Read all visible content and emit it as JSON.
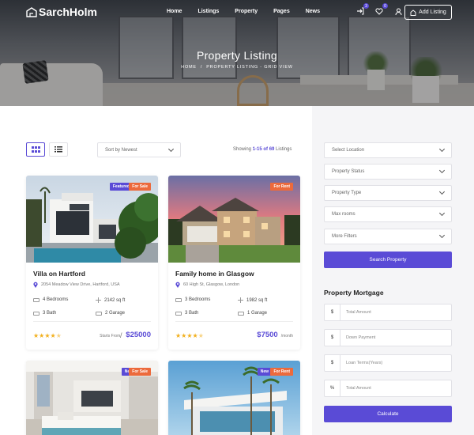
{
  "brand": {
    "name": "SarchHolm",
    "accent": "#5a4bd6",
    "tag_orange": "#ec6a3c"
  },
  "nav": {
    "items": [
      "Home",
      "Listings",
      "Property",
      "Pages",
      "News"
    ],
    "icons": [
      {
        "name": "sign-in-icon",
        "badge": "3"
      },
      {
        "name": "heart-icon",
        "badge": "0"
      },
      {
        "name": "user-icon",
        "badge": ""
      }
    ],
    "add_listing": "Add Listing"
  },
  "hero": {
    "title": "Property Listing",
    "breadcrumb": [
      "HOME",
      "PROPERTY LISTING - GRID VIEW"
    ]
  },
  "toolbar": {
    "sort": "Sort by Newest",
    "showing_prefix": "Showing",
    "showing_range": "1-15 of 69",
    "showing_suffix": "Listings"
  },
  "listings": [
    {
      "tags": [
        "Featured",
        "For Sale"
      ],
      "title": "Villa on Hartford",
      "address": "2054 Meadow View Drive, Hartford, USA",
      "beds": "4 Bedrooms",
      "area": "2142 sq ft",
      "baths": "3 Bath",
      "garage": "2 Garage",
      "rating": 3.5,
      "price_prefix": "Starts From",
      "price": "$25000",
      "price_suffix": ""
    },
    {
      "tags": [
        "For Rent"
      ],
      "title": "Family home in Glasgow",
      "address": "60 High St, Glasgow, London",
      "beds": "3 Bedrooms",
      "area": "1982 sq ft",
      "baths": "3 Bath",
      "garage": "1 Garage",
      "rating": 3.5,
      "price_prefix": "",
      "price": "$7500",
      "price_suffix": "/month"
    },
    {
      "tags": [
        "New",
        "For Sale"
      ]
    },
    {
      "tags": [
        "New",
        "For Rent"
      ]
    }
  ],
  "sidebar": {
    "selects": [
      "Select Location",
      "Property Status",
      "Property Type",
      "Max rooms",
      "More Filters"
    ],
    "search_button": "Search Property",
    "mortgage_title": "Property Mortgage",
    "mortgage_fields": [
      {
        "prefix": "$",
        "placeholder": "Total Amount"
      },
      {
        "prefix": "$",
        "placeholder": "Down Payment"
      },
      {
        "prefix": "$",
        "placeholder": "Loan Terms(Years)"
      },
      {
        "prefix": "%",
        "placeholder": "Total Amount"
      }
    ],
    "calculate_button": "Calculate"
  }
}
